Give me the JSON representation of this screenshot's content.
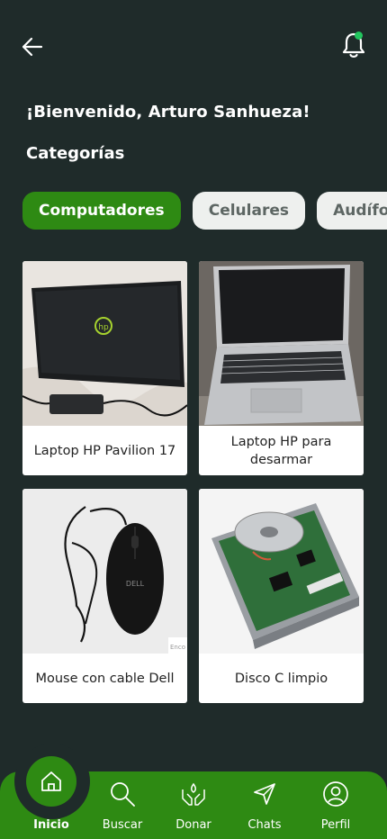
{
  "header": {
    "back_icon": "arrow-left-icon",
    "notification_icon": "bell-icon",
    "notification_dot_color": "#22c55e"
  },
  "greeting": "¡Bienvenido, Arturo Sanhueza!",
  "categories_title": "Categorías",
  "categories": [
    {
      "label": "Computadores",
      "active": true
    },
    {
      "label": "Celulares",
      "active": false
    },
    {
      "label": "Audífonos",
      "active": false
    }
  ],
  "products": [
    {
      "name": "Laptop HP Pavilion 17",
      "image": "black-hp-laptop-with-charger"
    },
    {
      "name": "Laptop HP para desarmar",
      "image": "silver-open-laptop"
    },
    {
      "name": "Mouse con cable Dell",
      "image": "black-dell-wired-mouse",
      "watermark": "Enco"
    },
    {
      "name": "Disco C limpio",
      "image": "hard-disk-drive"
    }
  ],
  "nav": {
    "home": "Inicio",
    "search": "Buscar",
    "donate": "Donar",
    "chats": "Chats",
    "profile": "Perfil"
  },
  "colors": {
    "background": "#1f2b2a",
    "accent": "#2e8a13",
    "chip_inactive": "#eef0ee"
  }
}
